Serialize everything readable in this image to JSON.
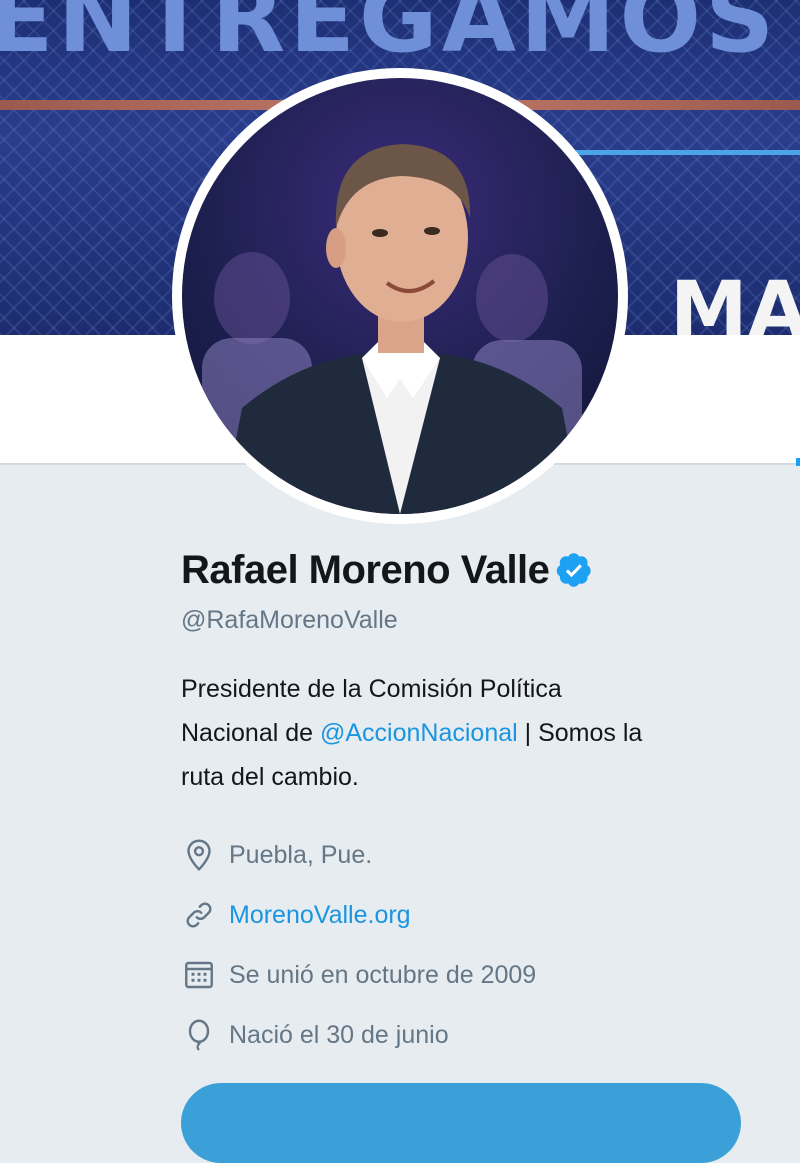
{
  "banner": {
    "headline_text": "ENTREGAMOS",
    "badge_text": "MA"
  },
  "profile": {
    "name": "Rafael Moreno Valle",
    "verified": true,
    "handle": "@RafaMorenoValle",
    "bio": {
      "line1": "Presidente de la Comisión Política",
      "line2_prefix": "Nacional de ",
      "mention": "@AccionNacional",
      "line2_suffix": " | Somos la",
      "line3": "ruta del cambio."
    },
    "location": "Puebla, Pue.",
    "website": "MorenoValle.org",
    "joined": "Se unió en octubre de 2009",
    "birthday": "Nació el 30 de junio"
  },
  "icons": {
    "location": "location-pin-icon",
    "website": "link-icon",
    "joined": "calendar-icon",
    "birthday": "balloon-icon",
    "verified": "verified-badge-icon"
  },
  "colors": {
    "link": "#1b95e0",
    "verified": "#1da1f2",
    "secondary_text": "#657786",
    "primary_text": "#14171a",
    "page_bg": "#e6ecf0",
    "button": "#3ba0d8"
  }
}
